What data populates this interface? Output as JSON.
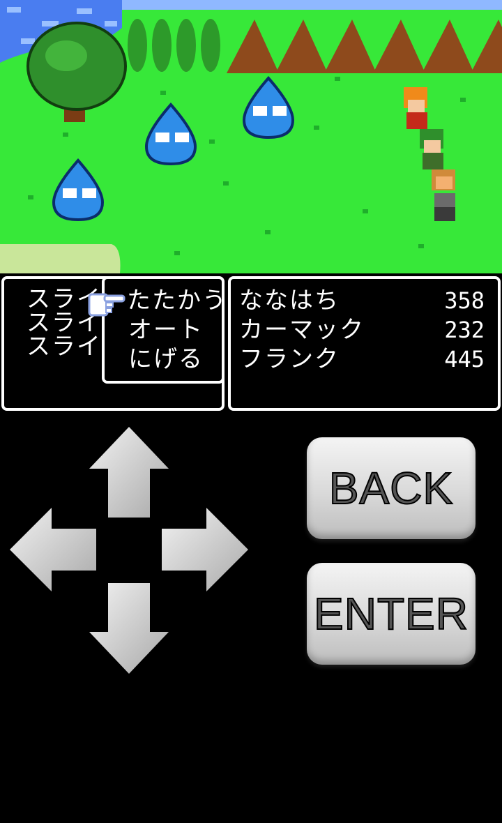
{
  "battle": {
    "enemy_list": [
      "スライ",
      "スライ",
      "スライ"
    ],
    "commands": [
      "たたかう",
      "オート",
      "にげる"
    ],
    "selected_command": "たたかう",
    "party": [
      {
        "name": "ななはち",
        "hp": "358"
      },
      {
        "name": "カーマック",
        "hp": "232"
      },
      {
        "name": "フランク",
        "hp": "445"
      }
    ]
  },
  "controls": {
    "back_label": "BACK",
    "enter_label": "ENTER",
    "dpad": [
      "up-arrow-icon",
      "down-arrow-icon",
      "left-arrow-icon",
      "right-arrow-icon"
    ]
  },
  "colors": {
    "grass": "#37e839",
    "slime": "#2f8de8",
    "water": "#4a7df0",
    "panel_border": "#ffffff"
  }
}
